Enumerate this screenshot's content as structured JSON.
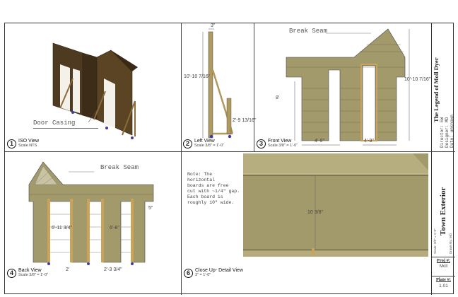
{
  "views": [
    {
      "number": "1",
      "title": "ISO View",
      "scale": "Scale NTS"
    },
    {
      "number": "2",
      "title": "Left View",
      "scale": "Scale 3/8\" = 1'-0\""
    },
    {
      "number": "3",
      "title": "Front View",
      "scale": "Scale 3/8\" = 1'-0\""
    },
    {
      "number": "4",
      "title": "Back View",
      "scale": "Scale 3/8\" = 1'-0\""
    },
    {
      "number": "6",
      "title": "Close Up- Detail View",
      "scale": "3\" = 1'-0\""
    }
  ],
  "annotations": {
    "door_casing": "Door Casing",
    "break_seam_front": "Break Seam",
    "break_seam_back": "Break Seam"
  },
  "dimensions": {
    "left_top": "3\"",
    "left_height": "10'-10 7/16\"",
    "left_base": "2'-9 13/16\"",
    "front_height_left": "8'",
    "front_height_right": "10'-10 7/16\"",
    "front_opening_left": "4'-9\"",
    "front_opening_right": "4'-9\"",
    "back_door_left": "6'-11 3/4\"",
    "back_door_right": "6'-8\"",
    "back_side": "5\"",
    "back_bottom_left": "2'",
    "back_bottom_mid": "2'-3 3/4\"",
    "detail_board": "10 3/8\""
  },
  "note": [
    "Note: The",
    "horizontal",
    "boards are free",
    "cut with ~1/4\" gap.",
    "Each board is",
    "roughly 10\" wide."
  ],
  "title_block": {
    "project": "The Legend of Moll Dyer",
    "director": "Director: EW",
    "designer": "Designer: MD",
    "date": "Date: unknown",
    "sheet_title": "Town Exterior",
    "scale_note": "Scale: 3/8\" = 1'-0\"",
    "drawn_by": "Drawn By: MD",
    "proj_label": "Proj #:",
    "proj_value": "Moll",
    "plate_label": "Plate #:",
    "plate_value": "1.01"
  },
  "colors": {
    "wood": "#a39a6c",
    "wood_dark": "#5a4424",
    "casing": "#c9a35a",
    "line": "#444444"
  }
}
